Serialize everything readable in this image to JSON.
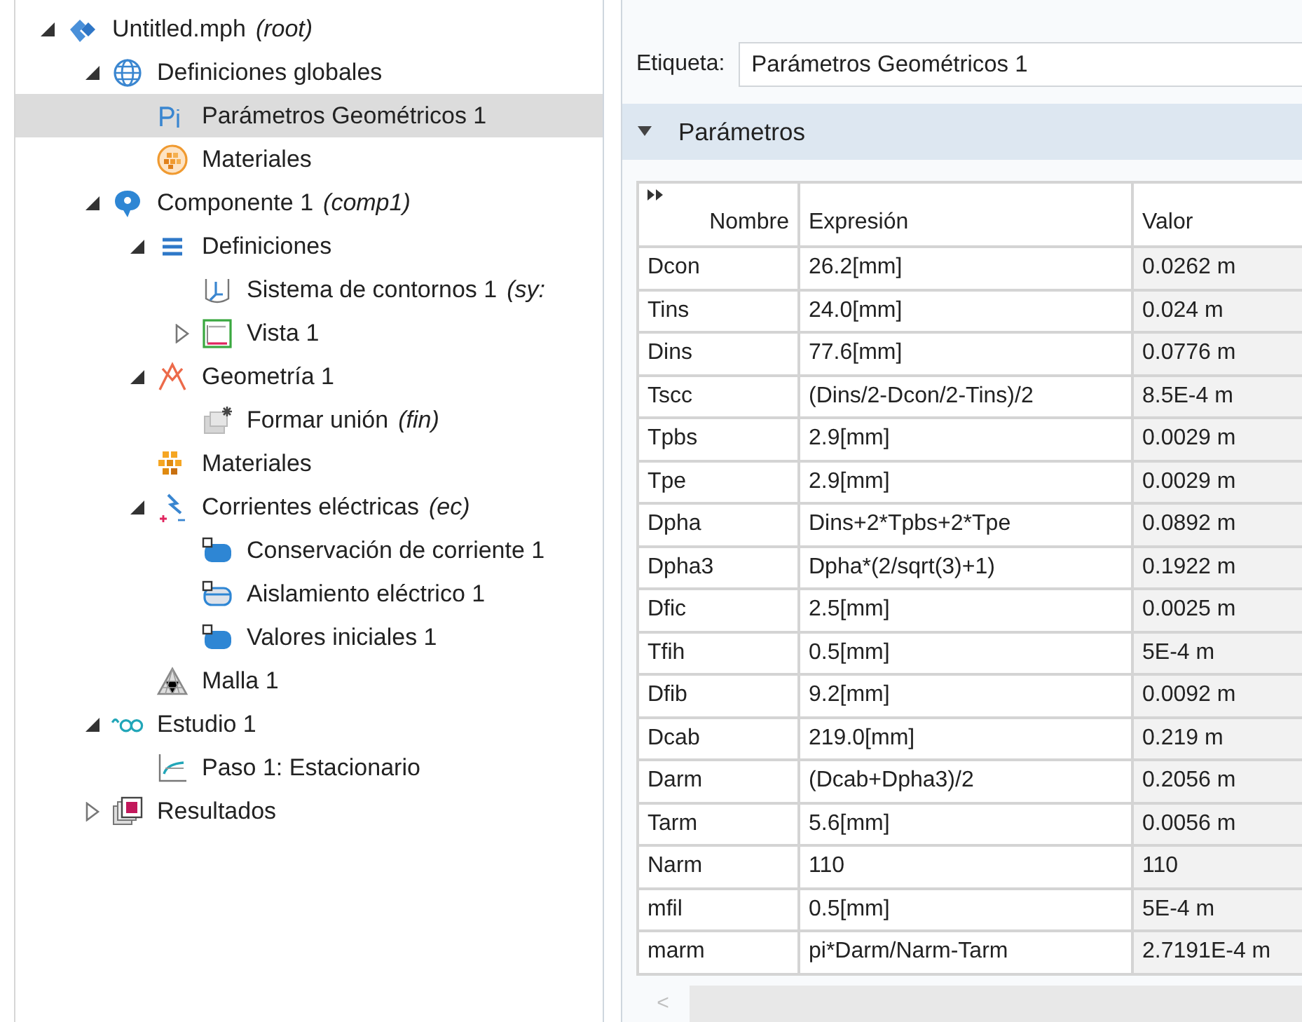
{
  "tree": [
    {
      "label": "Untitled.mph",
      "suffix": "(root)",
      "kind": "root",
      "expanded": true,
      "selected": false,
      "children": [
        {
          "label": "Definiciones globales",
          "kind": "globals",
          "expanded": true,
          "selected": false,
          "children": [
            {
              "label": "Parámetros Geométricos 1",
              "kind": "parameters",
              "selected": true
            },
            {
              "label": "Materiales",
              "kind": "global-materials",
              "selected": false
            }
          ]
        },
        {
          "label": "Componente 1",
          "suffix": "(comp1)",
          "kind": "component",
          "expanded": true,
          "selected": false,
          "children": [
            {
              "label": "Definiciones",
              "kind": "definitions",
              "expanded": true,
              "selected": false,
              "children": [
                {
                  "label": "Sistema de contornos 1",
                  "suffix": "(sy:",
                  "kind": "coordinate-system",
                  "selected": false
                },
                {
                  "label": "Vista 1",
                  "kind": "view",
                  "expanded": false,
                  "selected": false
                }
              ]
            },
            {
              "label": "Geometría 1",
              "kind": "geometry",
              "expanded": true,
              "selected": false,
              "children": [
                {
                  "label": "Formar unión",
                  "suffix": "(fin)",
                  "kind": "form-union",
                  "selected": false
                }
              ]
            },
            {
              "label": "Materiales",
              "kind": "materials",
              "selected": false
            },
            {
              "label": "Corrientes eléctricas",
              "suffix": "(ec)",
              "kind": "physics",
              "expanded": true,
              "selected": false,
              "children": [
                {
                  "label": "Conservación de corriente 1",
                  "kind": "domain",
                  "selected": false
                },
                {
                  "label": "Aislamiento eléctrico 1",
                  "kind": "boundary",
                  "selected": false
                },
                {
                  "label": "Valores iniciales 1",
                  "kind": "domain",
                  "selected": false
                }
              ]
            },
            {
              "label": "Malla 1",
              "kind": "mesh",
              "selected": false
            }
          ]
        },
        {
          "label": "Estudio 1",
          "kind": "study",
          "expanded": true,
          "selected": false,
          "children": [
            {
              "label": "Paso 1: Estacionario",
              "kind": "step",
              "selected": false
            }
          ]
        },
        {
          "label": "Resultados",
          "kind": "results",
          "expanded": false,
          "selected": false
        }
      ]
    }
  ],
  "settings": {
    "label_caption": "Etiqueta:",
    "label_value": "Parámetros Geométricos 1",
    "section": {
      "title": "Parámetros",
      "expanded": true
    },
    "table": {
      "columns": [
        "Nombre",
        "Expresión",
        "Valor"
      ],
      "rows": [
        [
          "Dcon",
          "26.2[mm]",
          "0.0262 m"
        ],
        [
          "Tins",
          "24.0[mm]",
          "0.024 m"
        ],
        [
          "Dins",
          "77.6[mm]",
          "0.0776 m"
        ],
        [
          "Tscc",
          "(Dins/2-Dcon/2-Tins)/2",
          "8.5E-4 m"
        ],
        [
          "Tpbs",
          "2.9[mm]",
          "0.0029 m"
        ],
        [
          "Tpe",
          "2.9[mm]",
          "0.0029 m"
        ],
        [
          "Dpha",
          "Dins+2*Tpbs+2*Tpe",
          "0.0892 m"
        ],
        [
          "Dpha3",
          "Dpha*(2/sqrt(3)+1)",
          "0.1922 m"
        ],
        [
          "Dfic",
          "2.5[mm]",
          "0.0025 m"
        ],
        [
          "Tfih",
          "0.5[mm]",
          "5E-4 m"
        ],
        [
          "Dfib",
          "9.2[mm]",
          "0.0092 m"
        ],
        [
          "Dcab",
          "219.0[mm]",
          "0.219 m"
        ],
        [
          "Darm",
          "(Dcab+Dpha3)/2",
          "0.2056 m"
        ],
        [
          "Tarm",
          "5.6[mm]",
          "0.0056 m"
        ],
        [
          "Narm",
          "110",
          "110"
        ],
        [
          "mfil",
          "0.5[mm]",
          "5E-4 m"
        ],
        [
          "marm",
          "pi*Darm/Narm-Tarm",
          "2.7191E-4 m"
        ]
      ]
    },
    "scroll_left": "<"
  }
}
